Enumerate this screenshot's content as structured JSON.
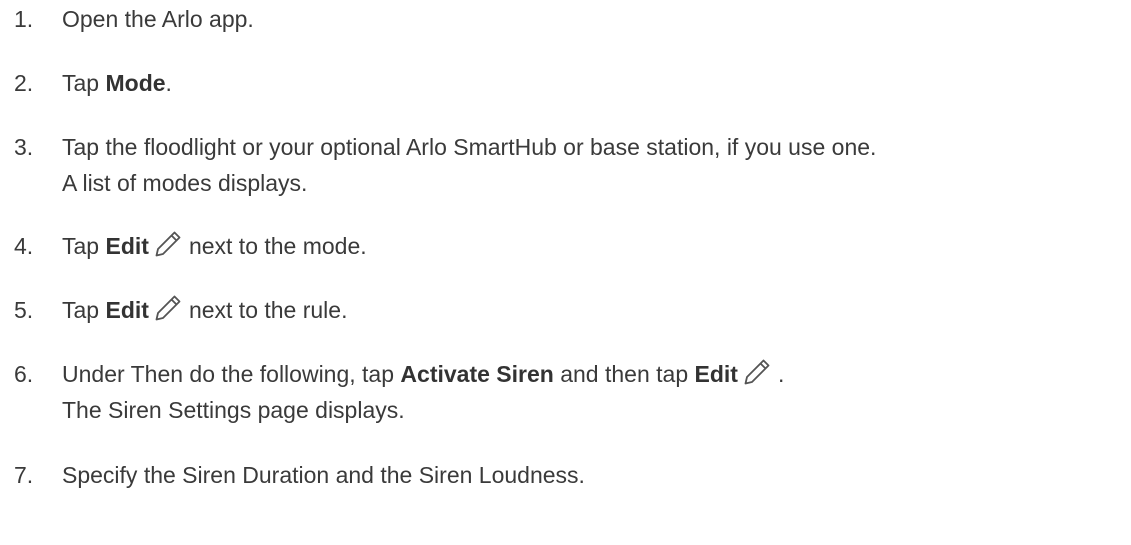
{
  "steps": [
    {
      "number": "1.",
      "text": "Open the Arlo app."
    },
    {
      "number": "2.",
      "pre": "Tap ",
      "bold": "Mode",
      "post": "."
    },
    {
      "number": "3.",
      "line1": "Tap the floodlight or your optional Arlo SmartHub or base station, if you use one.",
      "line2": "A list of modes displays."
    },
    {
      "number": "4.",
      "pre": "Tap ",
      "bold": "Edit",
      "icon": "pencil-edit-icon",
      "post": "next to the mode."
    },
    {
      "number": "5.",
      "pre": "Tap ",
      "bold": "Edit",
      "icon": "pencil-edit-icon",
      "post": "next to the rule."
    },
    {
      "number": "6.",
      "pre": "Under Then do the following, tap ",
      "bold": "Activate Siren",
      "mid": " and then tap ",
      "bold2": "Edit",
      "icon": "pencil-edit-icon",
      "post": ".",
      "line2": "The Siren Settings page displays."
    },
    {
      "number": "7.",
      "text": "Specify the Siren Duration and the Siren Loudness."
    }
  ],
  "colors": {
    "text": "#3a3a3a",
    "icon_stroke": "#555555"
  }
}
